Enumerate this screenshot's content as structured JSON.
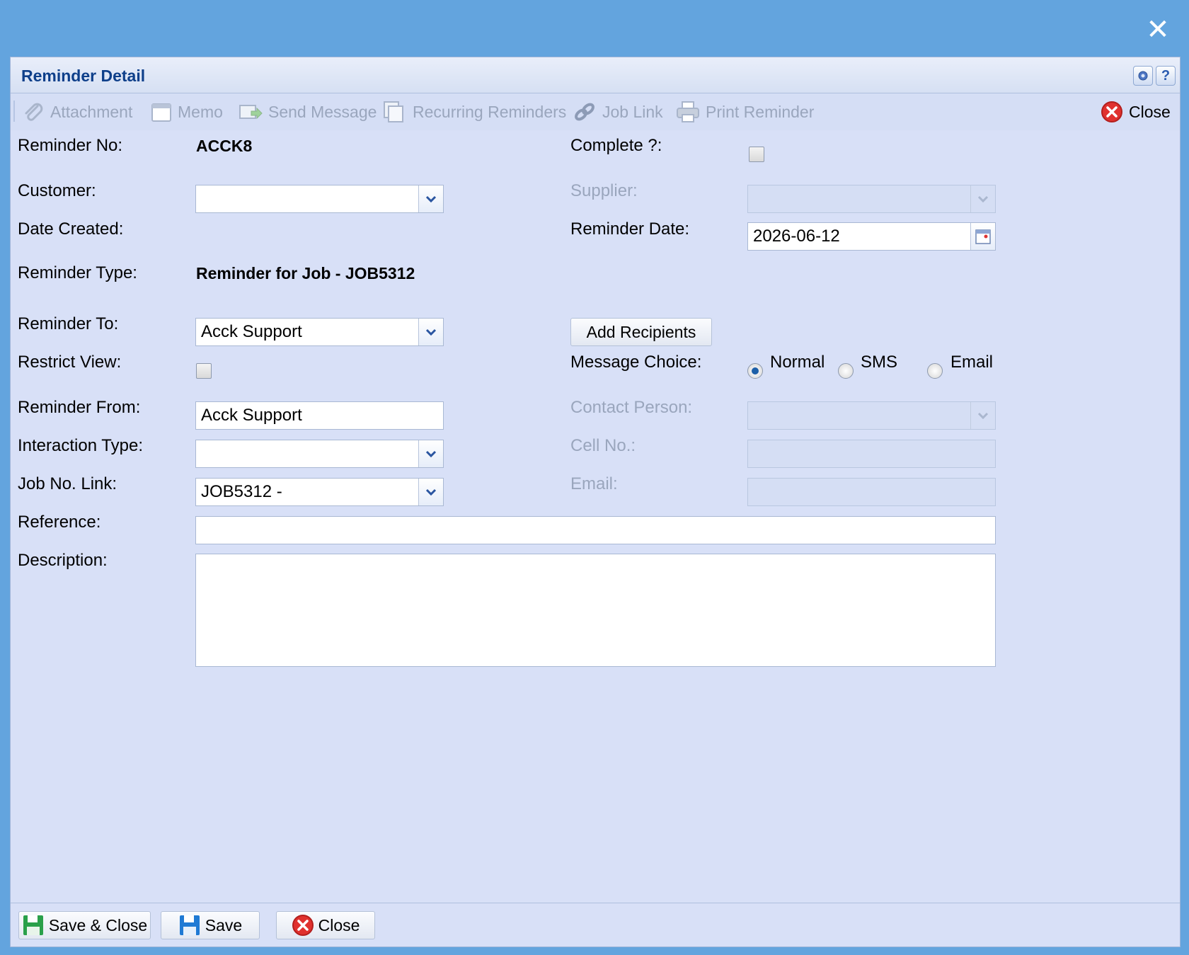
{
  "dialog": {
    "title": "Reminder Detail",
    "settings_icon": "gear-icon",
    "help_label": "?",
    "close_overlay_icon": "close-icon"
  },
  "toolbar": {
    "attachment": "Attachment",
    "memo": "Memo",
    "send_message": "Send Message",
    "recurring_reminders": "Recurring Reminders",
    "job_link": "Job Link",
    "print_reminder": "Print Reminder",
    "close": "Close"
  },
  "form": {
    "reminder_no_label": "Reminder No:",
    "reminder_no_value": "ACCK8",
    "complete_label": "Complete ?:",
    "complete_checked": false,
    "customer_label": "Customer:",
    "customer_value": "",
    "supplier_label": "Supplier:",
    "supplier_value": "",
    "date_created_label": "Date Created:",
    "date_created_value": "",
    "reminder_date_label": "Reminder Date:",
    "reminder_date_value": "2026-06-12",
    "reminder_type_label": "Reminder Type:",
    "reminder_type_value": "Reminder for Job - JOB5312",
    "reminder_to_label": "Reminder To:",
    "reminder_to_value": "Acck Support",
    "add_recipients": "Add Recipients",
    "restrict_view_label": "Restrict View:",
    "restrict_view_checked": false,
    "message_choice_label": "Message Choice:",
    "message_choice_options": [
      "Normal",
      "SMS",
      "Email"
    ],
    "message_choice_selected": "Normal",
    "reminder_from_label": "Reminder From:",
    "reminder_from_value": "Acck Support",
    "contact_person_label": "Contact Person:",
    "contact_person_value": "",
    "interaction_type_label": "Interaction Type:",
    "interaction_type_value": "",
    "cell_no_label": "Cell No.:",
    "cell_no_value": "",
    "job_no_link_label": "Job No. Link:",
    "job_no_link_value": "JOB5312 -",
    "email_label": "Email:",
    "email_value": "",
    "reference_label": "Reference:",
    "reference_value": "",
    "description_label": "Description:",
    "description_value": ""
  },
  "footer": {
    "save_close": "Save & Close",
    "save": "Save",
    "close": "Close"
  },
  "colors": {
    "backdrop": "#63a4de",
    "window": "#d8e0f7",
    "title_text": "#0e3f8a",
    "disabled_text": "#9aa6bd",
    "save_icon": "#2aa04a",
    "close_icon": "#e0312e"
  }
}
